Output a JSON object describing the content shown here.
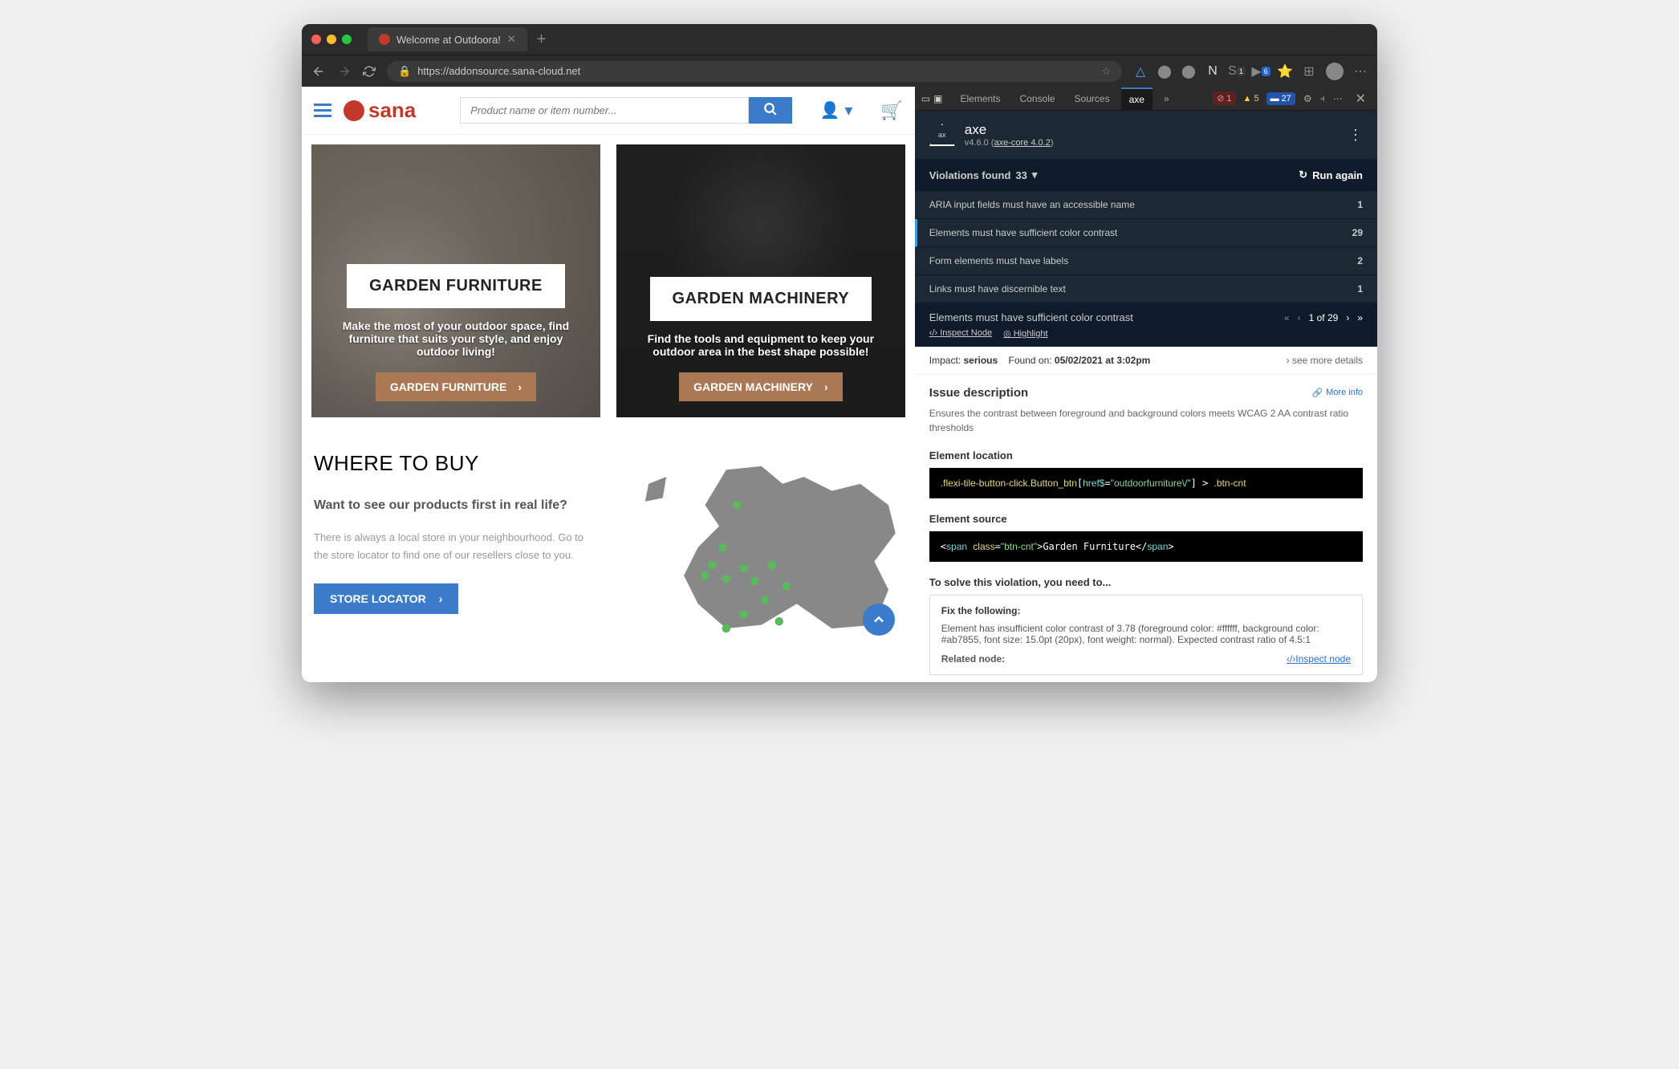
{
  "browser": {
    "tab_title": "Welcome at Outdoora!",
    "url": "https://addonsource.sana-cloud.net"
  },
  "page": {
    "logo_text": "sana",
    "search_placeholder": "Product name or item number...",
    "tiles": [
      {
        "title": "GARDEN FURNITURE",
        "desc": "Make the most of your outdoor space, find furniture that suits your style, and enjoy outdoor living!",
        "btn": "GARDEN FURNITURE"
      },
      {
        "title": "GARDEN MACHINERY",
        "desc": "Find the tools and equipment to keep your outdoor area in the best shape possible!",
        "btn": "GARDEN MACHINERY"
      }
    ],
    "where": {
      "title": "WHERE TO BUY",
      "sub": "Want to see our products first in real life?",
      "text": "There is always a local store in your neighbourhood. Go to the store locator to find one of our resellers close to you.",
      "btn": "STORE LOCATOR"
    }
  },
  "devtools": {
    "tabs": [
      "Elements",
      "Console",
      "Sources",
      "axe"
    ],
    "errors": {
      "red": "1",
      "yellow": "5",
      "blue": "27"
    },
    "axe": {
      "title": "axe",
      "version": "v4.6.0",
      "core": "axe-core 4.0.2",
      "violations_label": "Violations found",
      "violations_count": "33",
      "run_again": "Run again",
      "rules": [
        {
          "name": "ARIA input fields must have an accessible name",
          "count": "1"
        },
        {
          "name": "Elements must have sufficient color contrast",
          "count": "29",
          "selected": true
        },
        {
          "name": "Form elements must have labels",
          "count": "2"
        },
        {
          "name": "Links must have discernible text",
          "count": "1"
        }
      ],
      "issue": {
        "title": "Elements must have sufficient color contrast",
        "nav": "1 of 29",
        "inspect_node": "Inspect Node",
        "highlight": "Highlight",
        "impact_label": "Impact:",
        "impact": "serious",
        "found_label": "Found on:",
        "found": "05/02/2021 at 3:02pm",
        "more_details": "see more details",
        "desc_h": "Issue description",
        "more_info": "More info",
        "desc": "Ensures the contrast between foreground and background colors meets WCAG 2 AA contrast ratio thresholds",
        "loc_h": "Element location",
        "loc_code": ".flexi-tile-button-click.Button_btn[href$=\"outdoorfurniture\\/\"] > .btn-cnt",
        "src_h": "Element source",
        "src_code": "<span class=\"btn-cnt\">Garden Furniture</span>",
        "solve_h": "To solve this violation, you need to...",
        "fix_h": "Fix the following:",
        "fix_text": "Element has insufficient color contrast of 3.78 (foreground color: #ffffff, background color: #ab7855, font size: 15.0pt (20px), font weight: normal). Expected contrast ratio of 4.5:1",
        "related_h": "Related node:",
        "inspect_link": "Inspect node"
      }
    }
  }
}
